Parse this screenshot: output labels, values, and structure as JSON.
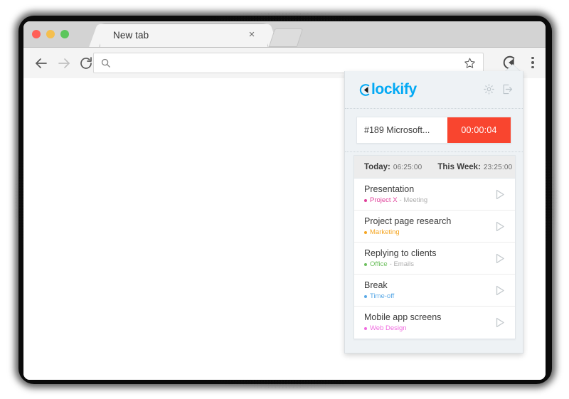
{
  "browser": {
    "traffic_lights": [
      "close",
      "minimize",
      "maximize"
    ],
    "tab": {
      "title": "New tab",
      "close_label": "×",
      "new_tab_name": "new-tab-button"
    },
    "toolbar": {
      "back_icon": "arrow-left-icon",
      "forward_icon": "arrow-right-icon",
      "reload_icon": "reload-icon",
      "search_icon": "search-icon",
      "address_value": "",
      "address_placeholder": "",
      "bookmark_icon": "star-icon",
      "extension_icon": "clockify-extension-icon",
      "menu_icon": "kebab-menu-icon"
    }
  },
  "popup": {
    "brand": {
      "name": "lockify",
      "mark": "clockify-logo-mark",
      "color": "#03a9f4"
    },
    "header_actions": [
      {
        "name": "settings-gear-icon",
        "label": "Settings"
      },
      {
        "name": "logout-icon",
        "label": "Log out"
      }
    ],
    "timer": {
      "description": "#189 Microsoft...",
      "elapsed": "00:00:04",
      "running_color": "#f9452f"
    },
    "totals": {
      "today_label": "Today:",
      "today_value": "06:25:00",
      "week_label": "This Week:",
      "week_value": "23:25:00"
    },
    "entries": [
      {
        "title": "Presentation",
        "project": "Project X",
        "project_color": "#e0409a",
        "task": "- Meeting",
        "play_icon": "play-icon"
      },
      {
        "title": "Project page research",
        "project": "Marketing",
        "project_color": "#f5a623",
        "task": "",
        "play_icon": "play-icon"
      },
      {
        "title": "Replying to clients",
        "project": "Office",
        "project_color": "#6ec05f",
        "task": "- Emails",
        "play_icon": "play-icon"
      },
      {
        "title": "Break",
        "project": "Time-off",
        "project_color": "#5aa9e6",
        "task": "",
        "play_icon": "play-icon"
      },
      {
        "title": "Mobile app screens",
        "project": "Web Design",
        "project_color": "#f06ce0",
        "task": "",
        "play_icon": "play-icon"
      }
    ]
  }
}
